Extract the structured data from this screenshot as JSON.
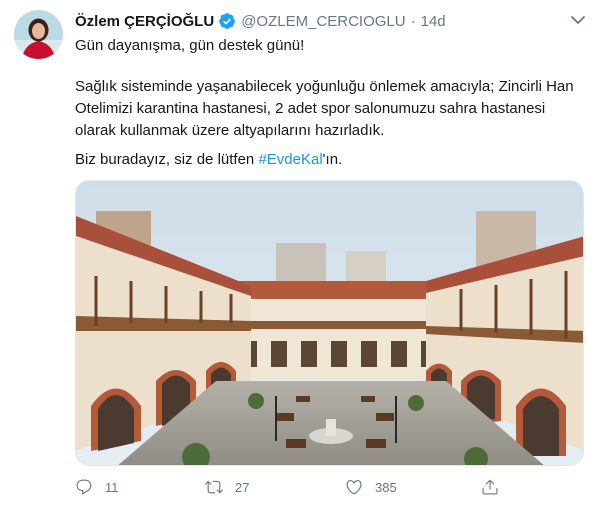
{
  "tweet": {
    "author_name": "Özlem ÇERÇİOĞLU",
    "handle": "@OZLEM_CERCIOGLU",
    "separator": "·",
    "time": "14d",
    "line1": "Gün dayanışma, gün destek günü!",
    "paragraph2": "Sağlık sisteminde yaşanabilecek yoğunluğu önlemek amacıyla; Zincirli Han Otelimizi karantina hastanesi, 2 adet spor salonumuzu sahra hastanesi olarak kullanmak üzere altyapılarını hazırladık.",
    "paragraph3_prefix": "Biz buradayız, siz de lütfen ",
    "hashtag": "#EvdeKal",
    "paragraph3_suffix": "'ın."
  },
  "actions": {
    "reply_count": "11",
    "retweet_count": "27",
    "like_count": "385"
  },
  "icons": {
    "verified": "verified-badge-icon",
    "caret": "chevron-down-icon",
    "reply": "reply-icon",
    "retweet": "retweet-icon",
    "like": "heart-icon",
    "share": "share-icon"
  },
  "colors": {
    "accent": "#1da1f2",
    "hashtag": "#1b95e0",
    "secondary_text": "#657786",
    "primary_text": "#14171a"
  }
}
